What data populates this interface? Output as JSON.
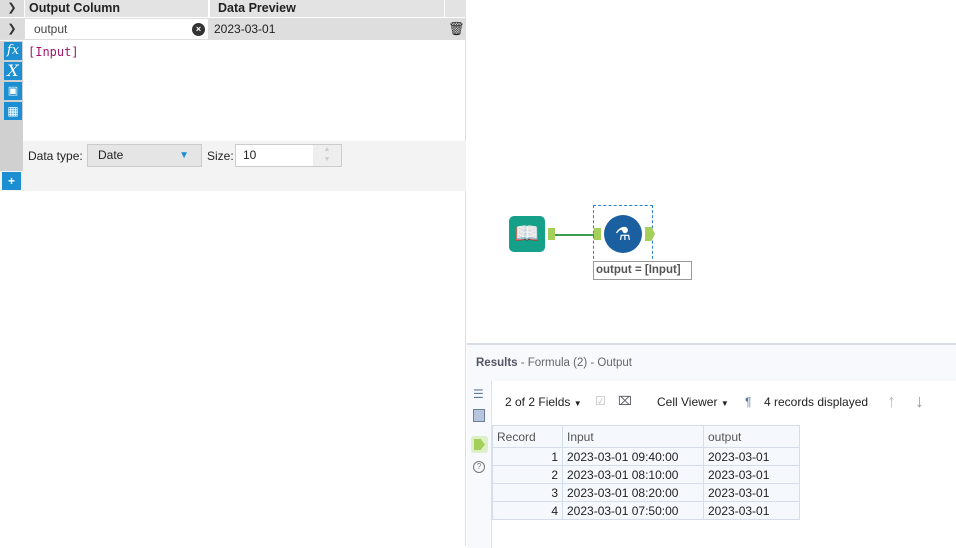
{
  "formula": {
    "header": {
      "output_column": "Output Column",
      "data_preview": "Data Preview"
    },
    "row": {
      "name": "output",
      "preview": "2023-03-01",
      "expression": "[Input]"
    },
    "data_type_label": "Data type:",
    "data_type": "Date",
    "size_label": "Size:",
    "size": "10"
  },
  "canvas": {
    "tool_label": "output = [Input]"
  },
  "results": {
    "title": "Results",
    "subtitle": " - Formula (2) - Output",
    "fields": "2 of 2 Fields",
    "cell_viewer": "Cell Viewer",
    "records": "4 records displayed",
    "columns": [
      "Record",
      "Input",
      "output"
    ],
    "rows": [
      [
        "1",
        "2023-03-01 09:40:00",
        "2023-03-01"
      ],
      [
        "2",
        "2023-03-01 08:10:00",
        "2023-03-01"
      ],
      [
        "3",
        "2023-03-01 08:20:00",
        "2023-03-01"
      ],
      [
        "4",
        "2023-03-01 07:50:00",
        "2023-03-01"
      ]
    ]
  }
}
